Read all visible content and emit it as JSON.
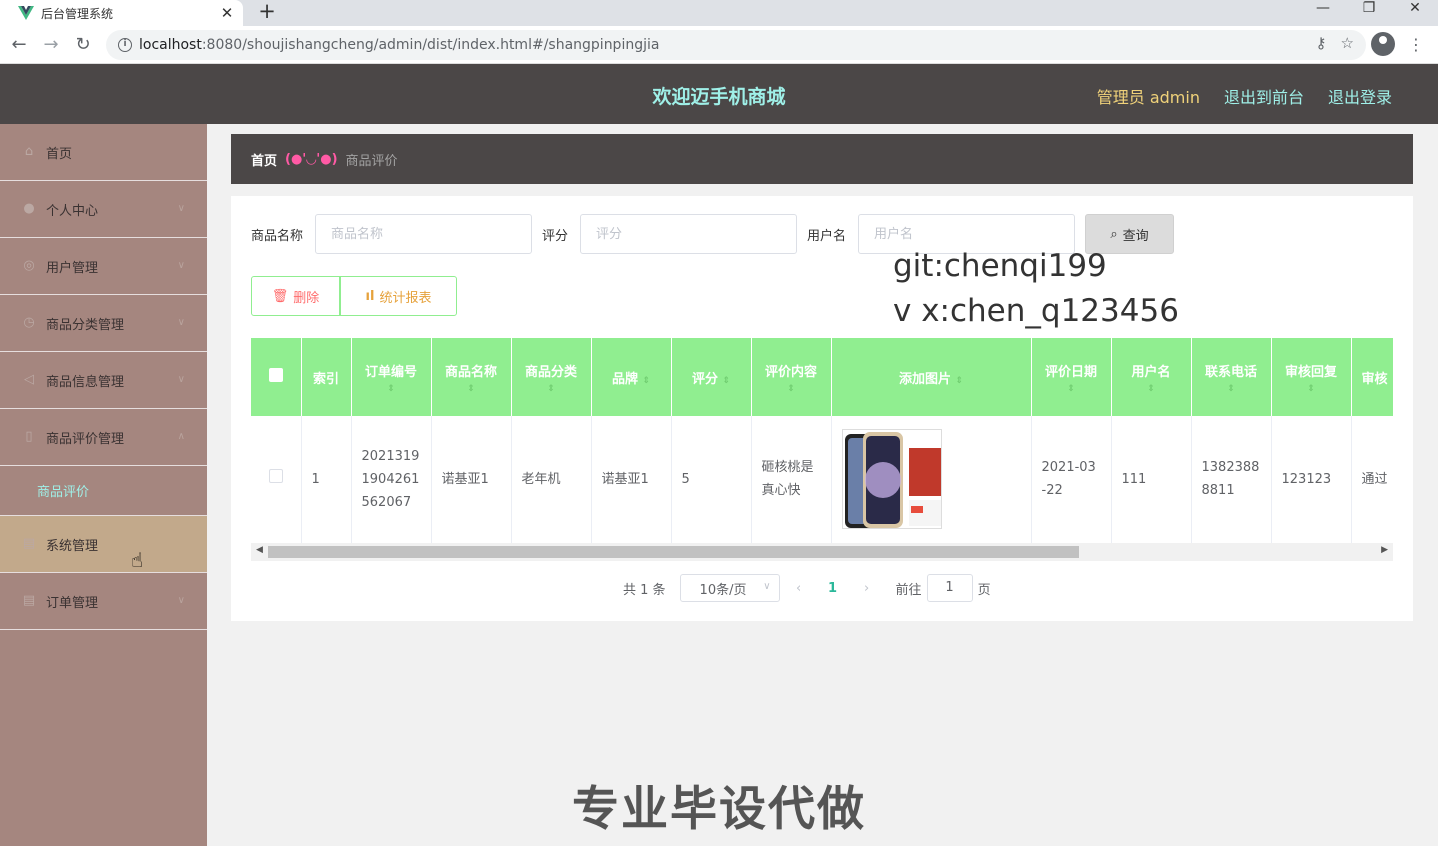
{
  "browser": {
    "tab_title": "后台管理系统",
    "url_host": "localhost",
    "url_path": ":8080/shoujishangcheng/admin/dist/index.html#/shangpinpingjia"
  },
  "header": {
    "title": "欢迎迈手机商城",
    "admin_label": "管理员 admin",
    "front_link": "退出到前台",
    "logout_link": "退出登录"
  },
  "sidebar": {
    "items": [
      {
        "label": "首页"
      },
      {
        "label": "个人中心"
      },
      {
        "label": "用户管理"
      },
      {
        "label": "商品分类管理"
      },
      {
        "label": "商品信息管理"
      },
      {
        "label": "商品评价管理"
      },
      {
        "label": "商品评价"
      },
      {
        "label": "系统管理"
      },
      {
        "label": "订单管理"
      }
    ]
  },
  "breadcrumb": {
    "home": "首页",
    "separator": "(●'◡'●)",
    "current": "商品评价"
  },
  "search": {
    "name_label": "商品名称",
    "name_placeholder": "商品名称",
    "score_label": "评分",
    "score_placeholder": "评分",
    "user_label": "用户名",
    "user_placeholder": "用户名",
    "query_btn": "查询"
  },
  "actions": {
    "delete_btn": "删除",
    "stats_btn": "统计报表"
  },
  "overlay": {
    "line1": "git:chenqi199",
    "line2": "v x:chen_q123456",
    "bottom": "专业毕设代做"
  },
  "table": {
    "headers": [
      "索引",
      "订单编号",
      "商品名称",
      "商品分类",
      "品牌",
      "评分",
      "评价内容",
      "添加图片",
      "评价日期",
      "用户名",
      "联系电话",
      "审核回复",
      "审核"
    ],
    "rows": [
      {
        "index": "1",
        "order_no": "2021319 1904261 562067",
        "product_name": "诺基亚1",
        "category": "老年机",
        "brand": "诺基亚1",
        "score": "5",
        "content": "砸核桃是真心快",
        "date": "2021-03 -22",
        "username": "111",
        "phone": "1382388 8811",
        "reply": "123123",
        "status": "通过"
      }
    ]
  },
  "pagination": {
    "total": "共 1 条",
    "page_size": "10条/页",
    "current_page": "1",
    "goto_label": "前往",
    "goto_value": "1",
    "page_suffix": "页"
  },
  "colors": {
    "header_bg": "#4b4747",
    "sidebar_bg": "#a5867f",
    "table_header": "#90ee90",
    "accent": "#9ff0e8"
  }
}
